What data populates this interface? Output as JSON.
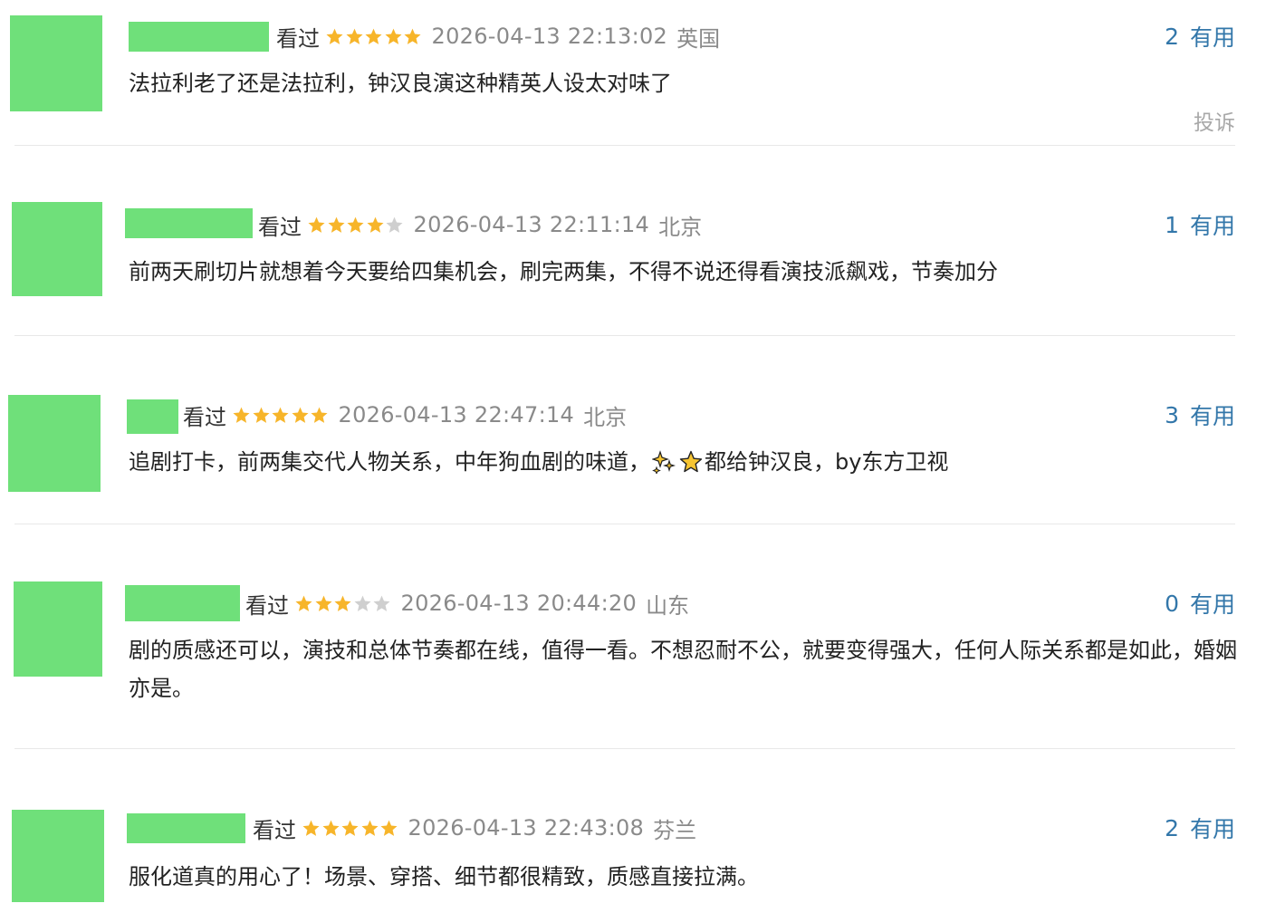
{
  "watched_label": "看过",
  "useful_label": "有用",
  "report_label": "投诉",
  "colors": {
    "avatar_placeholder": "#6fe07a",
    "star_filled": "#f7b52a",
    "star_empty": "#cfcfcf",
    "link_blue": "#3377aa",
    "meta_gray": "#8a8a8a"
  },
  "comments": [
    {
      "rating": 5,
      "time": "2026-04-13 22:13:02",
      "location": "英国",
      "useful_count": "2",
      "text": "法拉利老了还是法拉利，钟汉良演这种精英人设太对味了"
    },
    {
      "rating": 4,
      "time": "2026-04-13 22:11:14",
      "location": "北京",
      "useful_count": "1",
      "text": "前两天刷切片就想着今天要给四集机会，刷完两集，不得不说还得看演技派飙戏，节奏加分"
    },
    {
      "rating": 5,
      "time": "2026-04-13 22:47:14",
      "location": "北京",
      "useful_count": "3",
      "text_before": "追剧打卡，前两集交代人物关系，中年狗血剧的味道，",
      "emoji_icons": [
        "sparkle-icon",
        "star-icon"
      ],
      "text_after": "都给钟汉良，by东方卫视"
    },
    {
      "rating": 3,
      "time": "2026-04-13 20:44:20",
      "location": "山东",
      "useful_count": "0",
      "text": "剧的质感还可以，演技和总体节奏都在线，值得一看。不想忍耐不公，就要变得强大，任何人际关系都是如此，婚姻亦是。"
    },
    {
      "rating": 5,
      "time": "2026-04-13 22:43:08",
      "location": "芬兰",
      "useful_count": "2",
      "text": "服化道真的用心了！场景、穿搭、细节都很精致，质感直接拉满。"
    }
  ]
}
